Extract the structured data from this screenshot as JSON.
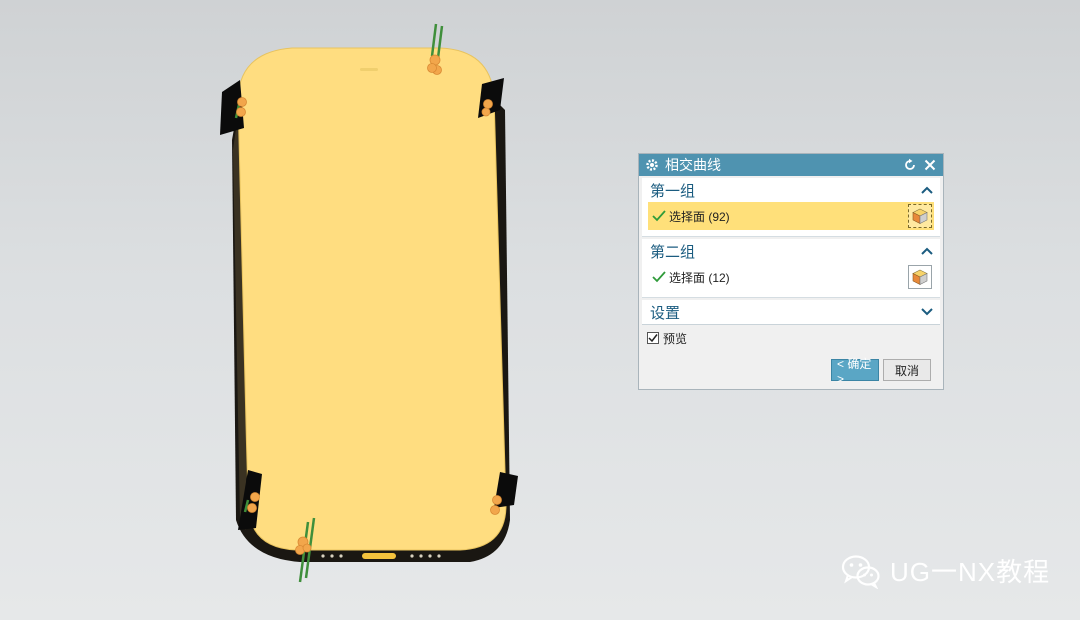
{
  "dialog": {
    "title": "相交曲线",
    "group1": {
      "header": "第一组",
      "select_label": "选择面 (92)"
    },
    "group2": {
      "header": "第二组",
      "select_label": "选择面 (12)"
    },
    "settings": {
      "header": "设置",
      "preview_label": "预览",
      "preview_checked": true
    },
    "ok_label": "< 确定 >",
    "cancel_label": "取消"
  },
  "watermark": {
    "text": "UG一NX教程"
  },
  "colors": {
    "phone_face": "#ffdd80",
    "titlebar": "#4f93b0",
    "accent_text": "#1b5c80",
    "active_row": "#ffe07a",
    "marker_orange": "#f2a64b",
    "marker_green": "#49a34a"
  },
  "icons": {
    "title": "gear-icon",
    "reset": "reset-icon",
    "close": "close-icon",
    "check": "check-icon",
    "face": "face-select-icon",
    "expand": "chevron-up-icon",
    "collapse": "chevron-down-icon",
    "wechat": "wechat-icon"
  }
}
